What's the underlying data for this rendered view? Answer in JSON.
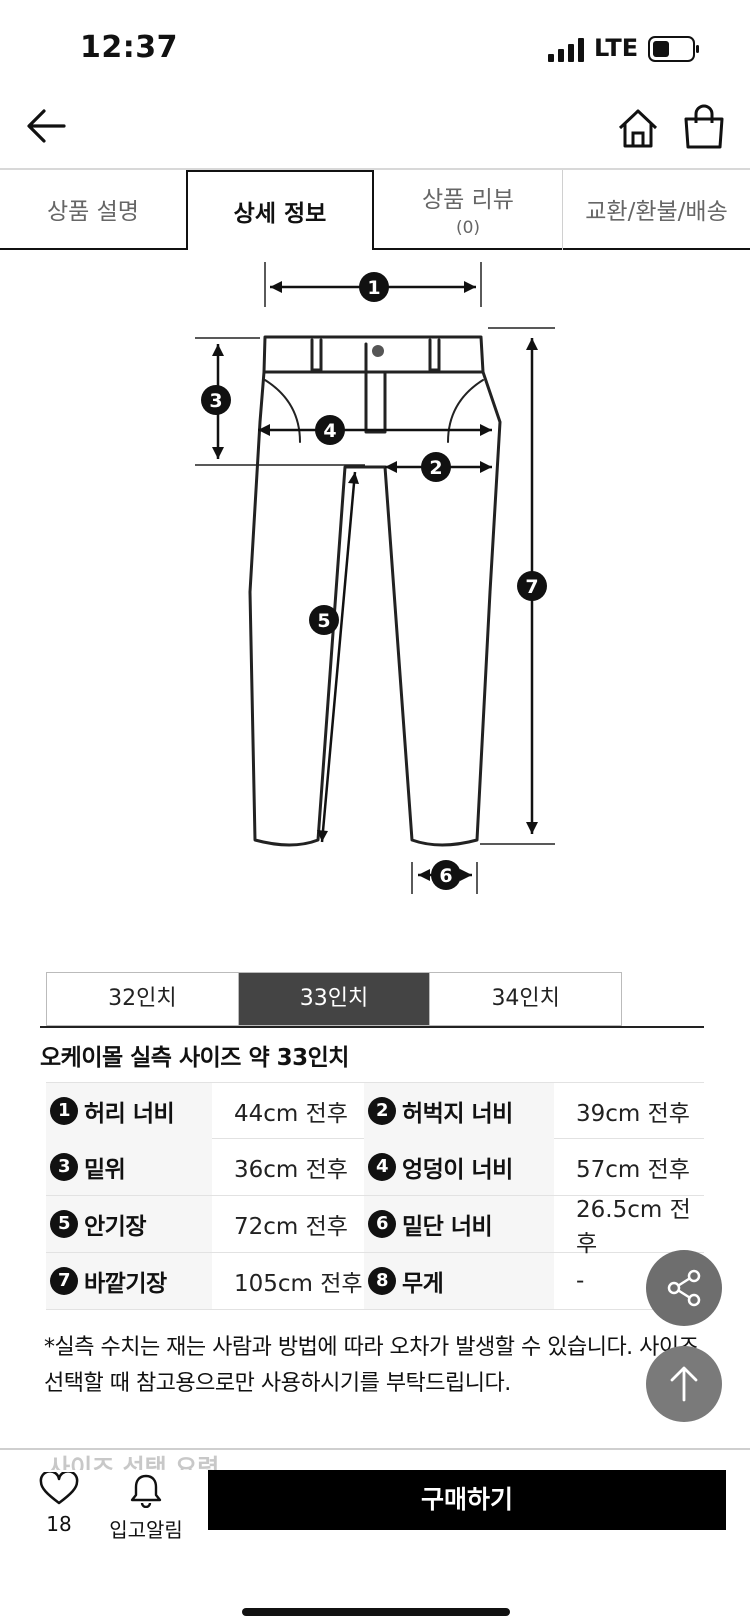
{
  "status_bar": {
    "time": "12:37",
    "network": "LTE"
  },
  "nav": {
    "back_icon": "arrow-left-icon",
    "home_icon": "home-icon",
    "cart_icon": "shopping-bag-icon"
  },
  "tabs": [
    {
      "label": "상품 설명",
      "sub": ""
    },
    {
      "label": "상세 정보",
      "sub": ""
    },
    {
      "label": "상품 리뷰",
      "sub": "(0)"
    },
    {
      "label": "교환/환불/배송",
      "sub": ""
    }
  ],
  "diagram": {
    "markers": [
      "1",
      "2",
      "3",
      "4",
      "5",
      "6",
      "7"
    ]
  },
  "sizes": {
    "options": [
      "32인치",
      "33인치",
      "34인치"
    ],
    "selected": "33인치"
  },
  "heading": "오케이몰 실측 사이즈 약 33인치",
  "measurements": [
    {
      "num": "1",
      "label": "허리 너비",
      "value": "44cm 전후"
    },
    {
      "num": "2",
      "label": "허벅지 너비",
      "value": "39cm 전후"
    },
    {
      "num": "3",
      "label": "밑위",
      "value": "36cm 전후"
    },
    {
      "num": "4",
      "label": "엉덩이 너비",
      "value": "57cm 전후"
    },
    {
      "num": "5",
      "label": "안기장",
      "value": "72cm 전후"
    },
    {
      "num": "6",
      "label": "밑단 너비",
      "value": "26.5cm 전후"
    },
    {
      "num": "7",
      "label": "바깥기장",
      "value": "105cm 전후"
    },
    {
      "num": "8",
      "label": "무게",
      "value": "-"
    }
  ],
  "note": "*실측 수치는 재는 사람과 방법에 따라 오차가 발생할 수 있습니다. 사이즈 선택할 때 참고용으로만 사용하시기를 부탁드립니다.",
  "fab": {
    "share_icon": "share-icon",
    "top_icon": "arrow-up-icon"
  },
  "bottom_bar": {
    "peek_text": "사이즈 선택 요령",
    "like_count": "18",
    "restock_label": "입고알림",
    "buy_label": "구매하기"
  }
}
